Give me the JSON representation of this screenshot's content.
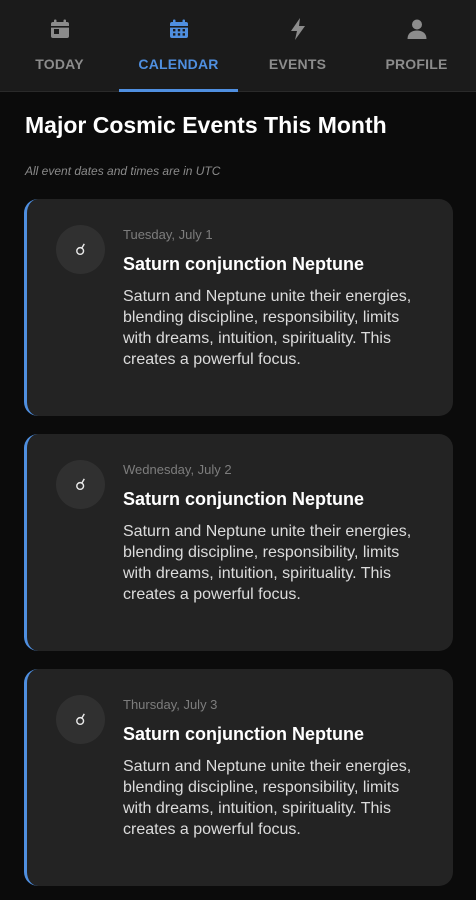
{
  "tabs": [
    {
      "label": "TODAY",
      "icon": "calendar-day-icon",
      "active": false
    },
    {
      "label": "CALENDAR",
      "icon": "calendar-month-icon",
      "active": true
    },
    {
      "label": "EVENTS",
      "icon": "lightning-bolt-icon",
      "active": false
    },
    {
      "label": "PROFILE",
      "icon": "person-icon",
      "active": false
    }
  ],
  "page": {
    "title": "Major Cosmic Events This Month",
    "note": "All event dates and times are in UTC"
  },
  "events": [
    {
      "symbol": "☌",
      "date": "Tuesday, July 1",
      "title": "Saturn conjunction Neptune",
      "description": "Saturn and Neptune unite their energies, blending discipline, responsibility, limits with dreams, intuition, spirituality. This creates a powerful focus."
    },
    {
      "symbol": "☌",
      "date": "Wednesday, July 2",
      "title": "Saturn conjunction Neptune",
      "description": "Saturn and Neptune unite their energies, blending discipline, responsibility, limits with dreams, intuition, spirituality. This creates a powerful focus."
    },
    {
      "symbol": "☌",
      "date": "Thursday, July 3",
      "title": "Saturn conjunction Neptune",
      "description": "Saturn and Neptune unite their energies, blending discipline, responsibility, limits with dreams, intuition, spirituality. This creates a powerful focus."
    }
  ],
  "colors": {
    "accent": "#4f8fe0",
    "background": "#0b0b0b",
    "tabbar": "#1b1b1b",
    "card": "#232323"
  }
}
